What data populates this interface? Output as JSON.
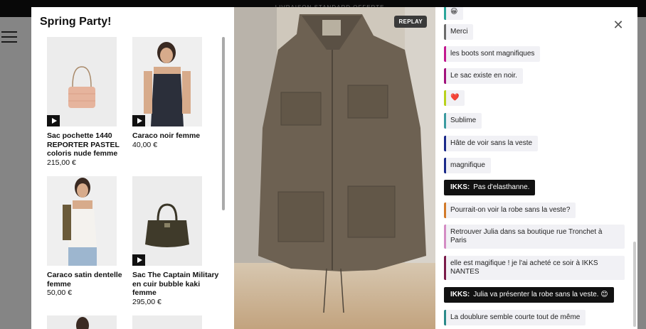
{
  "background": {
    "banner": "LIVRAISON STANDARD OFFERTE ..."
  },
  "products": {
    "title": "Spring Party!",
    "items": [
      {
        "name": "Sac pochette 1440 REPORTER PASTEL coloris nude femme",
        "price": "215,00 €",
        "has_video": true
      },
      {
        "name": "Caraco noir femme",
        "price": "40,00 €",
        "has_video": true
      },
      {
        "name": "Caraco satin dentelle femme",
        "price": "50,00 €",
        "has_video": false
      },
      {
        "name": "Sac The Captain Military en cuir bubble kaki femme",
        "price": "295,00 €",
        "has_video": true
      }
    ]
  },
  "video": {
    "replay_label": "REPLAY"
  },
  "chat": {
    "messages": [
      {
        "text": "😀",
        "color": "#2aa59a"
      },
      {
        "text": "Merci",
        "color": "#6b6b6b"
      },
      {
        "text": "les boots sont magnifiques",
        "color": "#c2188f"
      },
      {
        "text": "Le sac existe en noir.",
        "color": "#a1127c"
      },
      {
        "text": "❤️",
        "color": "#b8d21c"
      },
      {
        "text": "Sublime",
        "color": "#3b9aa0"
      },
      {
        "text": "Hâte de voir sans la veste",
        "color": "#1b2a8a"
      },
      {
        "text": "magnifique",
        "color": "#1b2a8a"
      },
      {
        "author": "IKKS:",
        "text": "Pas d'elasthanne."
      },
      {
        "text": "Pourrait-on voir la robe sans la veste?",
        "color": "#d27a2a"
      },
      {
        "text": "Retrouver Julia dans sa boutique rue Tronchet à Paris",
        "color": "#d48cc4"
      },
      {
        "text": "elle est magifique ! je l'ai acheté ce soir à IKKS NANTES",
        "color": "#7a1b4a"
      },
      {
        "author": "IKKS:",
        "text": "Julia va présenter la robe sans la veste. 😊"
      },
      {
        "text": "La doublure semble courte tout de même",
        "color": "#2a8a8a"
      }
    ]
  },
  "close_icon": "close-icon"
}
